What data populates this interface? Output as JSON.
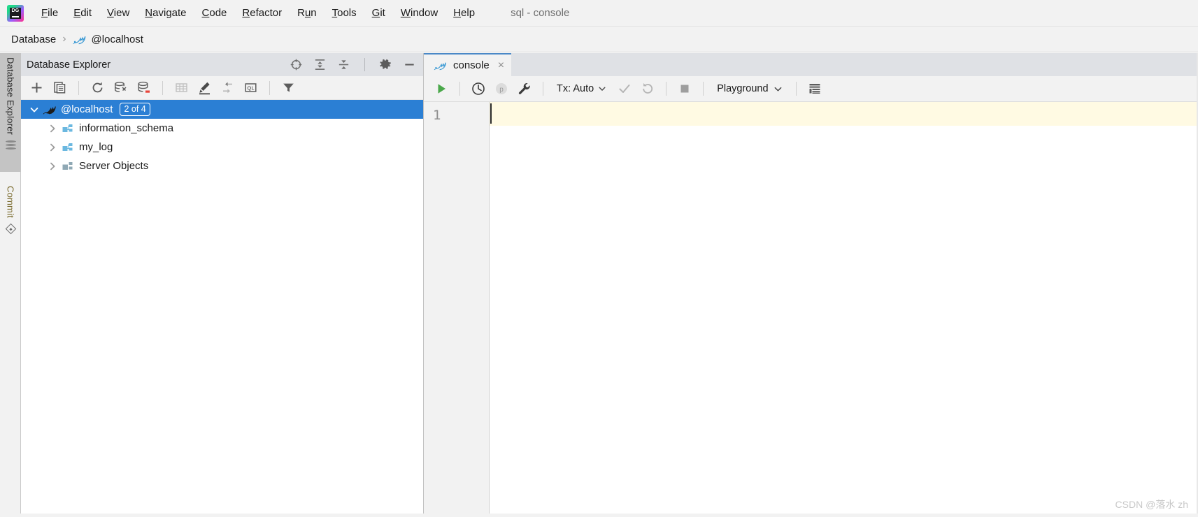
{
  "window": {
    "title": "sql - console",
    "app_icon": "datagrip-logo-icon"
  },
  "menubar": {
    "items": [
      {
        "label": "File",
        "mnemonic": "F"
      },
      {
        "label": "Edit",
        "mnemonic": "E"
      },
      {
        "label": "View",
        "mnemonic": "V"
      },
      {
        "label": "Navigate",
        "mnemonic": "N"
      },
      {
        "label": "Code",
        "mnemonic": "C"
      },
      {
        "label": "Refactor",
        "mnemonic": "R"
      },
      {
        "label": "Run",
        "mnemonic": "u"
      },
      {
        "label": "Tools",
        "mnemonic": "T"
      },
      {
        "label": "Git",
        "mnemonic": "G"
      },
      {
        "label": "Window",
        "mnemonic": "W"
      },
      {
        "label": "Help",
        "mnemonic": "H"
      }
    ]
  },
  "breadcrumb": {
    "root": "Database",
    "separator": "›",
    "leaf": "@localhost",
    "leaf_icon": "mysql-dolphin-icon"
  },
  "rail": {
    "tabs": [
      {
        "label": "Database Explorer",
        "icon": "database-icon"
      },
      {
        "label": "Commit",
        "icon": "commit-diamond-icon"
      }
    ]
  },
  "explorer": {
    "title": "Database Explorer",
    "header_icons": [
      "scroll-from-source-icon",
      "expand-all-icon",
      "collapse-all-icon",
      "settings-gear-icon",
      "hide-panel-icon"
    ],
    "toolbar_icons": [
      "add-new-icon",
      "copy-data-source-icon",
      "refresh-icon",
      "synchronize-icon",
      "stop-refresh-icon",
      "open-table-editor-icon",
      "modify-object-icon",
      "jump-to-editor-icon",
      "open-ql-console-icon",
      "filter-icon"
    ],
    "tree": [
      {
        "label": "@localhost",
        "icon": "mysql-dolphin-icon",
        "badge": "2 of 4",
        "expanded": true,
        "selected": true,
        "level": 0
      },
      {
        "label": "information_schema",
        "icon": "schema-icon",
        "expanded": false,
        "selected": false,
        "level": 1
      },
      {
        "label": "my_log",
        "icon": "schema-icon",
        "expanded": false,
        "selected": false,
        "level": 1
      },
      {
        "label": "Server Objects",
        "icon": "server-objects-folder-icon",
        "expanded": false,
        "selected": false,
        "level": 1
      }
    ]
  },
  "editor": {
    "tab": {
      "label": "console",
      "icon": "mysql-dolphin-icon",
      "close_label": "×"
    },
    "toolbar": {
      "execute_label": "execute-icon",
      "history_label": "history-clock-icon",
      "parameters_label": "parameters-p-icon",
      "settings_label": "wrench-icon",
      "tx_label": "Tx: Auto",
      "commit_label": "commit-check-icon",
      "rollback_label": "rollback-icon",
      "stop_label": "stop-icon",
      "schema_label": "Playground",
      "data_editor_label": "data-editor-icon"
    },
    "gutter": {
      "lines": [
        "1"
      ]
    },
    "content": ""
  },
  "watermark": "CSDN @落水 zh",
  "colors": {
    "selection_blue": "#2b7fd4",
    "caret_line_yellow": "#fffae3",
    "panel_header_gray": "#dfe1e5",
    "toolbar_gray": "#f2f2f2",
    "execute_green": "#4aa84a",
    "schema_blue": "#6bb8e0",
    "tab_underline_blue": "#4a88c7"
  }
}
